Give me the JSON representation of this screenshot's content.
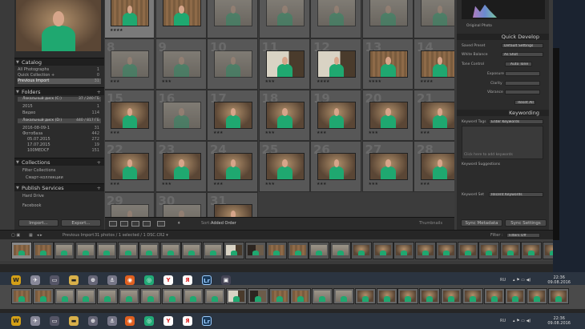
{
  "catalog": {
    "title": "Catalog",
    "items": [
      {
        "label": "All Photographs",
        "count": "1"
      },
      {
        "label": "Quick Collection +",
        "count": "0"
      },
      {
        "label": "Previous Import",
        "count": "31"
      }
    ]
  },
  "folders": {
    "title": "Folders",
    "volume1": {
      "label": "Локальный диск (C:)",
      "count": "37 / 240 ГБ"
    },
    "items": [
      {
        "label": "2015",
        "count": "1"
      },
      {
        "label": "Видео",
        "count": "114"
      }
    ],
    "volume2": {
      "label": "Локальный диск (D:)",
      "count": "440 / 817 ГБ"
    },
    "items2": [
      {
        "label": "2016-08-09-1",
        "count": "31"
      },
      {
        "label": "Фотобаза",
        "count": "442"
      },
      {
        "label": "05.07.2015",
        "count": "272"
      },
      {
        "label": "17.07.2015",
        "count": "19"
      },
      {
        "label": "100MEDCF",
        "count": "151"
      }
    ]
  },
  "collections": {
    "title": "Collections",
    "items": [
      {
        "label": "Filter Collections"
      },
      {
        "label": "Смарт-коллекции"
      }
    ]
  },
  "publish": {
    "title": "Publish Services",
    "items": [
      {
        "label": "Hard Drive"
      },
      {
        "label": "Facebook"
      }
    ]
  },
  "left_buttons": {
    "import": "Import...",
    "export": "Export..."
  },
  "grid": {
    "rows": [
      [
        {
          "n": "",
          "img": "pcurtain",
          "sel": true,
          "stars": "★★★★"
        },
        {
          "n": "",
          "img": "pcurtain",
          "stars": ""
        },
        {
          "n": "",
          "img": "pfade",
          "stars": ""
        },
        {
          "n": "",
          "img": "pfade",
          "stars": ""
        },
        {
          "n": "",
          "img": "pfade",
          "stars": ""
        },
        {
          "n": "",
          "img": "pfade",
          "stars": ""
        },
        {
          "n": "",
          "img": "pfade",
          "stars": ""
        }
      ],
      [
        {
          "n": "8",
          "img": "pfade",
          "stars": "★★★"
        },
        {
          "n": "9",
          "img": "pfade",
          "stars": "★★★"
        },
        {
          "n": "10",
          "img": "pfade",
          "stars": ""
        },
        {
          "n": "11",
          "img": "pwhite",
          "stars": "★★★"
        },
        {
          "n": "12",
          "img": "pwhite",
          "stars": "★★★★"
        },
        {
          "n": "13",
          "img": "pcurtain",
          "stars": "★★★★"
        },
        {
          "n": "14",
          "img": "pcurtain",
          "stars": "★★★★"
        }
      ],
      [
        {
          "n": "15",
          "img": "pbrick",
          "stars": "★★★"
        },
        {
          "n": "16",
          "img": "pfade",
          "stars": ""
        },
        {
          "n": "17",
          "img": "pbrick",
          "stars": "★★★"
        },
        {
          "n": "18",
          "img": "pbrick",
          "stars": "★★★"
        },
        {
          "n": "19",
          "img": "pbrick",
          "stars": "★★★"
        },
        {
          "n": "20",
          "img": "pbrick",
          "stars": "★★★"
        },
        {
          "n": "21",
          "img": "pbrick",
          "stars": "★★★"
        }
      ],
      [
        {
          "n": "22",
          "img": "pbrick",
          "stars": "★★★"
        },
        {
          "n": "23",
          "img": "pbrick",
          "stars": "★★★"
        },
        {
          "n": "24",
          "img": "pbrick",
          "stars": "★★★"
        },
        {
          "n": "25",
          "img": "pbrick",
          "stars": "★★★"
        },
        {
          "n": "26",
          "img": "pbrick",
          "stars": "★★★"
        },
        {
          "n": "27",
          "img": "pbrick",
          "stars": "★★★"
        },
        {
          "n": "28",
          "img": "pbrick",
          "stars": "★★★"
        }
      ],
      [
        {
          "n": "29",
          "img": "pfade",
          "stars": ""
        },
        {
          "n": "30",
          "img": "pfade",
          "stars": ""
        },
        {
          "n": "31",
          "img": "pbrick",
          "stars": ""
        }
      ]
    ]
  },
  "toolbar": {
    "sort_label": "Sort:",
    "sort_value": "Added Order",
    "thumbnails_label": "Thumbnails"
  },
  "right_panel": {
    "original_photo_label": "Original Photo",
    "quick_develop": {
      "title": "Quick Develop",
      "saved_preset_label": "Saved Preset",
      "saved_preset_value": "Default Settings",
      "white_balance_label": "White Balance",
      "white_balance_value": "As Shot",
      "tone_control_label": "Tone Control",
      "auto_tone": "Auto Tone",
      "exposure_label": "Exposure",
      "clarity_label": "Clarity",
      "vibrance_label": "Vibrance",
      "reset_all": "Reset All"
    },
    "keywording": {
      "title": "Keywording",
      "keyword_tags_label": "Keyword Tags",
      "keyword_tags_value": "Enter Keywords",
      "click_hint": "Click here to add keywords",
      "suggestions_label": "Keyword Suggestions",
      "keyword_set_label": "Keyword Set",
      "keyword_set_value": "Recent Keywords"
    },
    "sync_metadata": "Sync Metadata",
    "sync_settings": "Sync Settings"
  },
  "filmstrip_bar": {
    "source": "Previous Import",
    "info": "31 photos / 1 selected / 1 DSC.CR2 ▾",
    "filter_label": "Filter :",
    "filter_value": "Filters Off"
  },
  "taskbar1": {
    "lang": "RU",
    "time": "22:36",
    "date": "09.08.2016"
  },
  "taskbar2": {
    "lang": "RU",
    "time": "22:36",
    "date": "09.08.2016"
  }
}
